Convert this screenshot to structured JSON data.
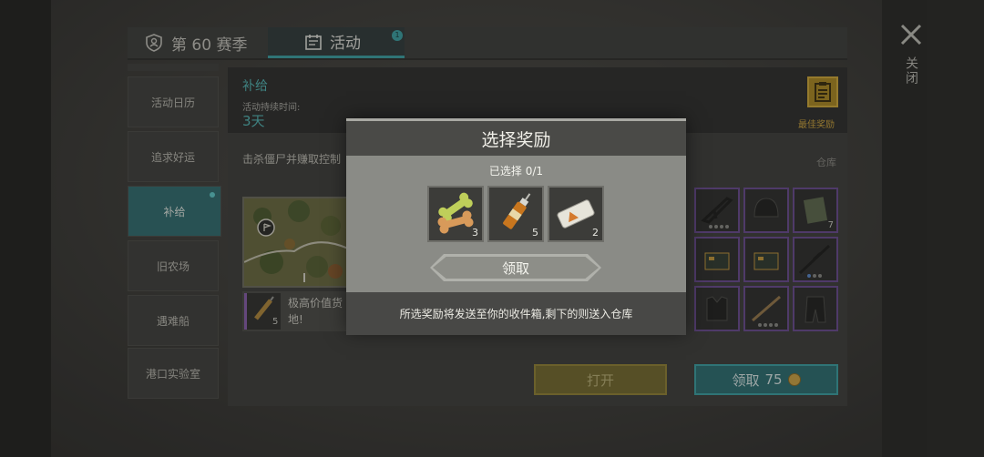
{
  "tabs": {
    "season": "第 60 赛季",
    "activity": "活动",
    "activity_badge": "1"
  },
  "close_label": "关闭",
  "sidebar": {
    "items": [
      {
        "label": "活动日历"
      },
      {
        "label": "追求好运"
      },
      {
        "label": "补给"
      },
      {
        "label": "旧农场"
      },
      {
        "label": "遇难船"
      },
      {
        "label": "港口实验室"
      }
    ],
    "active_index": 2
  },
  "supply": {
    "title": "补给",
    "duration_label": "活动持续时间:",
    "duration_value": "3天",
    "best_reward_label": "最佳奖励",
    "description": "击杀僵尸并赚取控制",
    "depot_label": "仓库",
    "item_count": "5",
    "item_text_line1": "极高价值货",
    "item_text_line2": "地!",
    "open_button": "打开",
    "claim_button": "领取",
    "claim_cost": "75",
    "grid_counts": [
      "",
      "",
      "7",
      "",
      "",
      "",
      "",
      "",
      ""
    ]
  },
  "modal": {
    "title": "选择奖励",
    "selected_text": "已选择 0/1",
    "rewards": [
      {
        "icon": "bone-icon",
        "count": "3"
      },
      {
        "icon": "syringe-icon",
        "count": "5"
      },
      {
        "icon": "bandage-icon",
        "count": "2"
      }
    ],
    "receive_button": "领取",
    "footer_text": "所选奖励将发送至你的收件箱,剩下的则送入仓库"
  },
  "colors": {
    "accent_teal": "#3aa4a6",
    "gold": "#d2a63a",
    "rare_purple": "#6a4a92"
  }
}
